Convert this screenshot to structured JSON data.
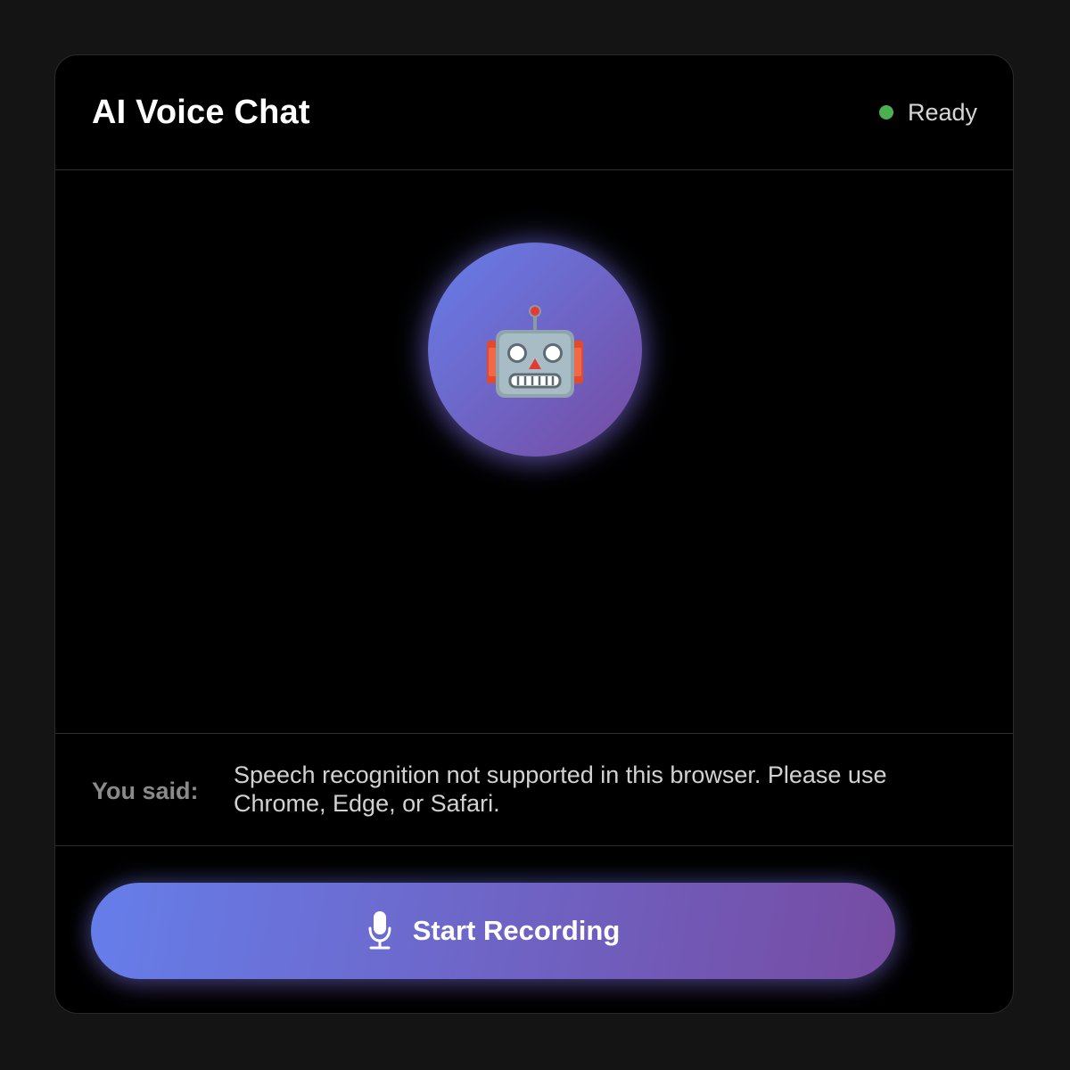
{
  "header": {
    "title": "AI Voice Chat",
    "status_label": "Ready",
    "status_color": "#4caf50"
  },
  "avatar": {
    "icon": "robot-icon",
    "gradient": [
      "#667eea",
      "#764ba2"
    ]
  },
  "transcript": {
    "label": "You said:",
    "text": "Speech recognition not supported in this browser. Please use Chrome, Edge, or Safari."
  },
  "controls": {
    "record_icon": "microphone-icon",
    "record_label": "Start Recording"
  }
}
